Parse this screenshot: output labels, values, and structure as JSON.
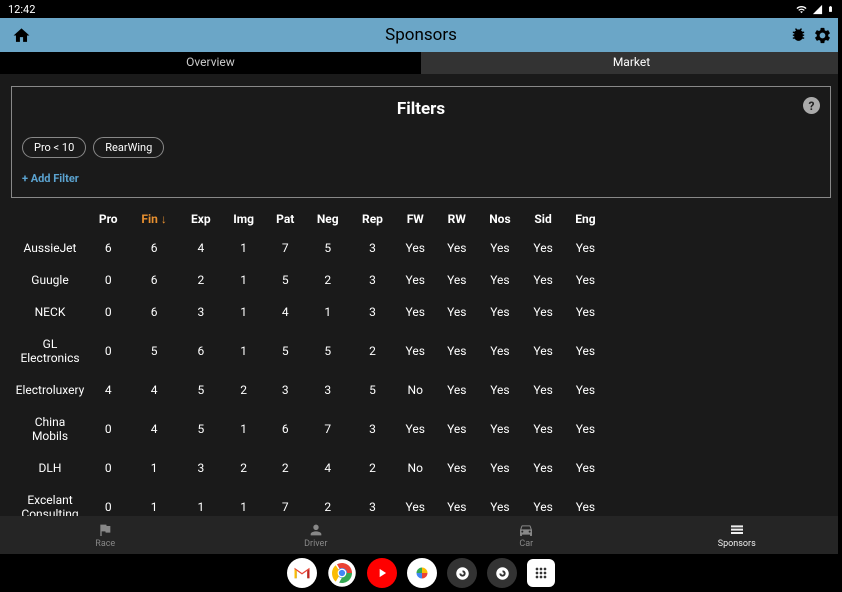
{
  "status": {
    "time": "12:42"
  },
  "appBar": {
    "title": "Sponsors"
  },
  "tabs": [
    {
      "label": "Overview",
      "active": false
    },
    {
      "label": "Market",
      "active": true
    }
  ],
  "filters": {
    "title": "Filters",
    "chips": [
      "Pro < 10",
      "RearWing"
    ],
    "addLabel": "+ Add Filter"
  },
  "table": {
    "headers": [
      "",
      "Pro",
      "Fin",
      "Exp",
      "Img",
      "Pat",
      "Neg",
      "Rep",
      "FW",
      "RW",
      "Nos",
      "Sid",
      "Eng"
    ],
    "sortCol": 2,
    "rows": [
      [
        "AussieJet",
        "6",
        "6",
        "4",
        "1",
        "7",
        "5",
        "3",
        "Yes",
        "Yes",
        "Yes",
        "Yes",
        "Yes"
      ],
      [
        "Guugle",
        "0",
        "6",
        "2",
        "1",
        "5",
        "2",
        "3",
        "Yes",
        "Yes",
        "Yes",
        "Yes",
        "Yes"
      ],
      [
        "NECK",
        "0",
        "6",
        "3",
        "1",
        "4",
        "1",
        "3",
        "Yes",
        "Yes",
        "Yes",
        "Yes",
        "Yes"
      ],
      [
        "GL Electronics",
        "0",
        "5",
        "6",
        "1",
        "5",
        "5",
        "2",
        "Yes",
        "Yes",
        "Yes",
        "Yes",
        "Yes"
      ],
      [
        "Electroluxery",
        "4",
        "4",
        "5",
        "2",
        "3",
        "3",
        "5",
        "No",
        "Yes",
        "Yes",
        "Yes",
        "Yes"
      ],
      [
        "China Mobils",
        "0",
        "4",
        "5",
        "1",
        "6",
        "7",
        "3",
        "Yes",
        "Yes",
        "Yes",
        "Yes",
        "Yes"
      ],
      [
        "DLH",
        "0",
        "1",
        "3",
        "2",
        "2",
        "4",
        "2",
        "No",
        "Yes",
        "Yes",
        "Yes",
        "Yes"
      ],
      [
        "Excelant Consulting",
        "0",
        "1",
        "1",
        "1",
        "7",
        "2",
        "3",
        "Yes",
        "Yes",
        "Yes",
        "Yes",
        "Yes"
      ]
    ]
  },
  "bottomNav": [
    {
      "label": "Race",
      "icon": "flag"
    },
    {
      "label": "Driver",
      "icon": "person"
    },
    {
      "label": "Car",
      "icon": "car"
    },
    {
      "label": "Sponsors",
      "icon": "sponsors",
      "active": true
    }
  ]
}
